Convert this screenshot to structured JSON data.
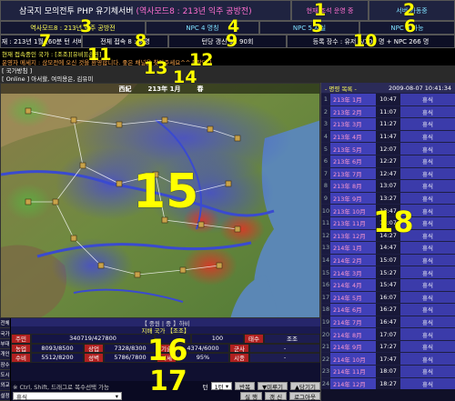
{
  "header": {
    "title": "삼국지 모의전투 PHP 유기체서버",
    "subtitle": "(역사모드8 : 213년 익주 공방전)",
    "status_label": "현재 조석",
    "status_value": "운영 중",
    "server_state": "서버 가동중",
    "mode": "역사모드8 : 213년 익주 공방전",
    "npc_state1": "NPC 4 명칭",
    "npc_state2": "NPC 5 사실",
    "npc_state3": "NPC 6 가능",
    "current_date": "현재 : 213년 1월 (60분 턴 서버)",
    "total_players": "전체 접속 8 : 8 명",
    "turn_wait": "턴당 갱신 9 : 90회",
    "registered": "등록 장수 : 유저 6/100 명 + NPC 266 명"
  },
  "messages": {
    "line1": "현재 접속중인 국가 : [조조][유비][손권]",
    "line2": "운영자 메세지 : 삼모전에 오신 것을 환영합니다. 좋은 채널을 찾아주세요^^  [ 잡담 ]",
    "line3": "[ 국가방침 ]",
    "line4": "[ Online ] 아서할, 여의용은, 김유미"
  },
  "map": {
    "era": "西紀",
    "year_month": "213年 1月",
    "season": "春"
  },
  "schedule": {
    "title": "- 명령 목록 -",
    "timestamp": "2009-08-07 10:41:34",
    "rows": [
      {
        "i": "1",
        "date": "213年 1月",
        "time": "10:47",
        "act": "휴식"
      },
      {
        "i": "2",
        "date": "213年 2月",
        "time": "11:07",
        "act": "휴식"
      },
      {
        "i": "3",
        "date": "213年 3月",
        "time": "11:27",
        "act": "휴식"
      },
      {
        "i": "4",
        "date": "213年 4月",
        "time": "11:47",
        "act": "휴식"
      },
      {
        "i": "5",
        "date": "213年 5月",
        "time": "12:07",
        "act": "휴식"
      },
      {
        "i": "6",
        "date": "213年 6月",
        "time": "12:27",
        "act": "휴식"
      },
      {
        "i": "7",
        "date": "213年 7月",
        "time": "12:47",
        "act": "휴식"
      },
      {
        "i": "8",
        "date": "213年 8月",
        "time": "13:07",
        "act": "휴식"
      },
      {
        "i": "9",
        "date": "213年 9月",
        "time": "13:27",
        "act": "휴식"
      },
      {
        "i": "10",
        "date": "213年 10月",
        "time": "13:47",
        "act": "휴식"
      },
      {
        "i": "11",
        "date": "213年 11月",
        "time": "14:07",
        "act": "휴식"
      },
      {
        "i": "12",
        "date": "213年 12月",
        "time": "14:27",
        "act": "휴식"
      },
      {
        "i": "13",
        "date": "214年 1月",
        "time": "14:47",
        "act": "휴식"
      },
      {
        "i": "14",
        "date": "214年 2月",
        "time": "15:07",
        "act": "휴식"
      },
      {
        "i": "15",
        "date": "214年 3月",
        "time": "15:27",
        "act": "휴식"
      },
      {
        "i": "16",
        "date": "214年 4月",
        "time": "15:47",
        "act": "휴식"
      },
      {
        "i": "17",
        "date": "214年 5月",
        "time": "16:07",
        "act": "휴식"
      },
      {
        "i": "18",
        "date": "214年 6月",
        "time": "16:27",
        "act": "휴식"
      },
      {
        "i": "19",
        "date": "214年 7月",
        "time": "16:47",
        "act": "휴식"
      },
      {
        "i": "20",
        "date": "214年 8月",
        "time": "17:07",
        "act": "휴식"
      },
      {
        "i": "21",
        "date": "214年 9月",
        "time": "17:27",
        "act": "휴식"
      },
      {
        "i": "22",
        "date": "214年 10月",
        "time": "17:47",
        "act": "휴식"
      },
      {
        "i": "23",
        "date": "214年 11月",
        "time": "18:07",
        "act": "휴식"
      },
      {
        "i": "24",
        "date": "214年 12月",
        "time": "18:27",
        "act": "휴식"
      }
    ]
  },
  "side_tabs": [
    "전체",
    "국가",
    "부대",
    "개인",
    "장수",
    "도시",
    "외교",
    "설정"
  ],
  "city": {
    "title": "【 중원 | 중 】하비",
    "subtitle": "지배 국가 【조조】",
    "rows": [
      {
        "l1": "주민",
        "v1": "340719/427800",
        "l2": "",
        "v2": "100",
        "l3": "태수",
        "v3": "조조"
      },
      {
        "l1": "농업",
        "v1": "8093/8500",
        "l2": "상업",
        "v2": "7328/8300",
        "l3": "기술",
        "v3": "4374/6000",
        "l4": "군사",
        "v4": "-"
      },
      {
        "l1": "수비",
        "v1": "5512/8200",
        "l2": "성벽",
        "v2": "5786/7800",
        "l3": "시세",
        "v3": "95%",
        "l4": "시종",
        "v4": "-"
      }
    ]
  },
  "commands": {
    "hint": "※ Ctrl, Shift, 드래그로 복수선택 가능",
    "select_value": "휴식",
    "turn_label": "턴",
    "turn_value": "1턴",
    "buttons": [
      "반복",
      "▼미루기",
      "▲당기기"
    ],
    "run": "실 행",
    "refresh": "갱 신",
    "logout": "로그아웃"
  },
  "overlay_numbers": [
    "1",
    "2",
    "3",
    "4",
    "5",
    "6",
    "7",
    "8",
    "9",
    "10",
    "11",
    "12",
    "13",
    "14",
    "15",
    "16",
    "17",
    "18"
  ],
  "colors": {
    "accent_yellow": "#ffff00",
    "header_bg": "#1f2340",
    "schedule_date_bg": "#4040b8",
    "city_label_red": "#b02020"
  }
}
